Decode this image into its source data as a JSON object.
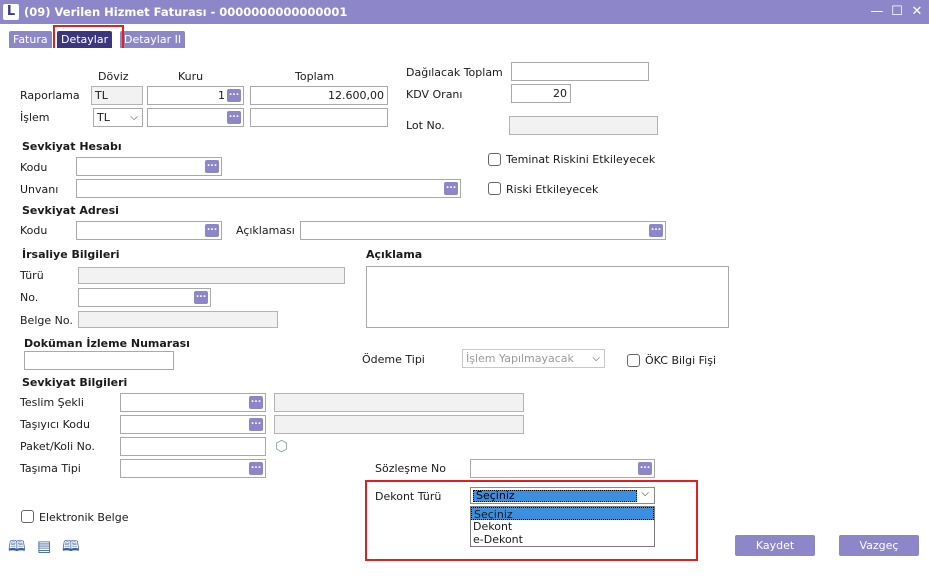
{
  "window": {
    "title": "(09) Verilen Hizmet Faturası - 0000000000000001",
    "logo": "L",
    "minimize": "—",
    "maximize": "☐",
    "close": "✕"
  },
  "tabs": [
    {
      "label": "Fatura"
    },
    {
      "label": "Detaylar",
      "active": true
    },
    {
      "label": "Detaylar II"
    }
  ],
  "currency": {
    "col_doviz": "Döviz",
    "col_kuru": "Kuru",
    "col_toplam": "Toplam",
    "raporlama_label": "Raporlama",
    "raporlama_doviz": "TL",
    "raporlama_kuru": "1",
    "raporlama_toplam": "12.600,00",
    "islem_label": "İşlem",
    "islem_doviz": "TL",
    "islem_kuru": "",
    "islem_toplam": ""
  },
  "right_top": {
    "dagilacak_label": "Dağılacak Toplam",
    "dagilacak_value": "",
    "kdv_label": "KDV Oranı",
    "kdv_value": "20",
    "lot_label": "Lot No.",
    "lot_value": ""
  },
  "sevkiyat_hesabi": {
    "section": "Sevkiyat Hesabı",
    "kodu_label": "Kodu",
    "kodu_value": "",
    "unvani_label": "Unvanı",
    "unvani_value": ""
  },
  "checks": {
    "teminat": "Teminat Riskini Etkileyecek",
    "riski": "Riski Etkileyecek",
    "okc": "ÖKC Bilgi Fişi",
    "elektronik": "Elektronik Belge"
  },
  "sevkiyat_adresi": {
    "section": "Sevkiyat Adresi",
    "kodu_label": "Kodu",
    "kodu_value": "",
    "aciklama_label": "Açıklaması",
    "aciklama_value": ""
  },
  "irsaliye": {
    "section": "İrsaliye Bilgileri",
    "turu_label": "Türü",
    "turu_value": "",
    "no_label": "No.",
    "no_value": "",
    "belge_label": "Belge No.",
    "belge_value": ""
  },
  "aciklama": {
    "section": "Açıklama",
    "value": ""
  },
  "dokuman": {
    "section": "Doküman İzleme Numarası",
    "value": ""
  },
  "odeme": {
    "label": "Ödeme Tipi",
    "value": "İşlem Yapılmayacak"
  },
  "sevkiyat_bilgileri": {
    "section": "Sevkiyat Bilgileri",
    "teslim_label": "Teslim Şekli",
    "teslim_value": "",
    "teslim_desc": "",
    "tasiyici_label": "Taşıyıcı Kodu",
    "tasiyici_value": "",
    "tasiyici_desc": "",
    "paket_label": "Paket/Koli No.",
    "paket_value": "",
    "tasima_label": "Taşıma Tipi",
    "tasima_value": ""
  },
  "sozlesme": {
    "label": "Sözleşme No",
    "value": ""
  },
  "dekont": {
    "label": "Dekont Türü",
    "selected": "Seçiniz",
    "options": [
      "Seçiniz",
      "Dekont",
      "e-Dekont"
    ]
  },
  "buttons": {
    "kaydet": "Kaydet",
    "vazgec": "Vazgeç"
  },
  "icons": {
    "dots": "...",
    "chevron": "⌵",
    "package": "⬡",
    "book1": "🕮",
    "doc": "▤",
    "book2": "🕮"
  }
}
